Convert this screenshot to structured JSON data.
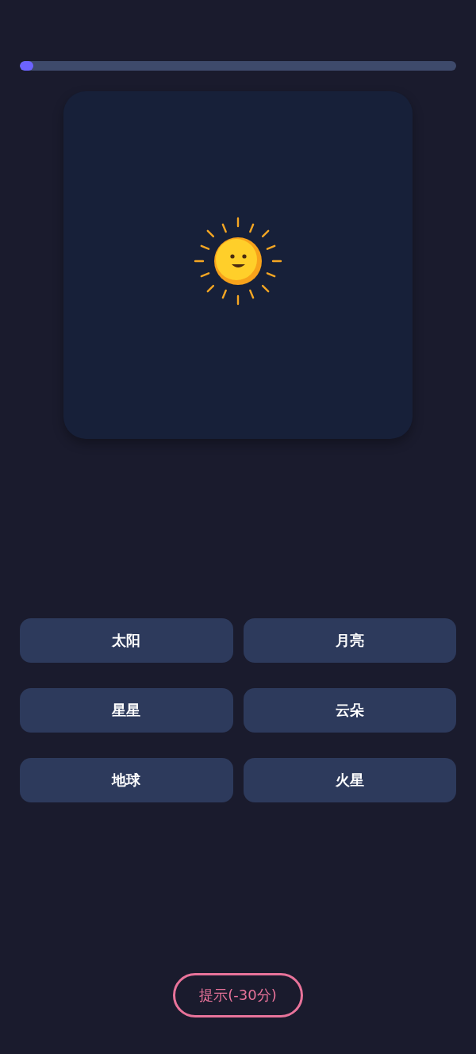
{
  "progress": {
    "level": 0.03
  },
  "options": [
    {
      "label": "太阳"
    },
    {
      "label": "月亮"
    },
    {
      "label": "星星"
    },
    {
      "label": "云朵"
    },
    {
      "label": "地球"
    },
    {
      "label": "火星"
    }
  ],
  "hint_button": {
    "label": "提示(-30分)"
  }
}
